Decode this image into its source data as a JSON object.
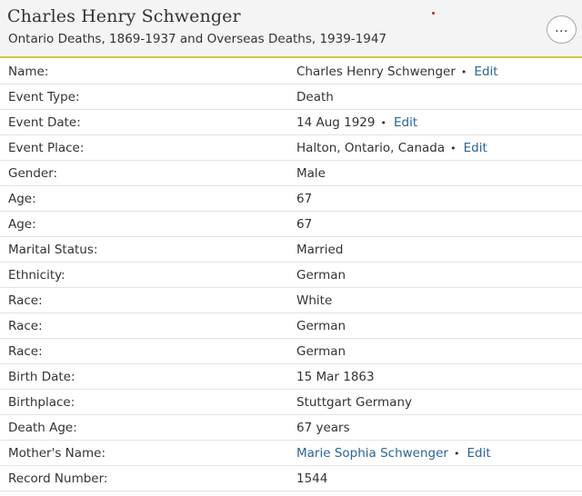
{
  "header": {
    "person_name": "Charles Henry Schwenger",
    "collection_title": "Ontario Deaths, 1869-1937 and Overseas Deaths, 1939-1947",
    "more_label": "...",
    "accent_color": "#c8cc3c"
  },
  "bullet": "•",
  "rows": [
    {
      "label": "Name:",
      "value": "Charles Henry Schwenger",
      "edit": "Edit"
    },
    {
      "label": "Event Type:",
      "value": "Death"
    },
    {
      "label": "Event Date:",
      "value": "14 Aug 1929",
      "edit": "Edit"
    },
    {
      "label": "Event Place:",
      "value": "Halton, Ontario, Canada",
      "edit": "Edit"
    },
    {
      "label": "Gender:",
      "value": "Male"
    },
    {
      "label": "Age:",
      "value": "67"
    },
    {
      "label": "Age:",
      "value": "67"
    },
    {
      "label": "Marital Status:",
      "value": "Married"
    },
    {
      "label": "Ethnicity:",
      "value": "German"
    },
    {
      "label": "Race:",
      "value": "White"
    },
    {
      "label": "Race:",
      "value": "German"
    },
    {
      "label": "Race:",
      "value": "German"
    },
    {
      "label": "Birth Date:",
      "value": "15 Mar 1863"
    },
    {
      "label": "Birthplace:",
      "value": "Stuttgart Germany"
    },
    {
      "label": "Death Age:",
      "value": "67 years"
    },
    {
      "label": "Mother's Name:",
      "value": "Marie Sophia Schwenger",
      "edit": "Edit"
    },
    {
      "label": "Record Number:",
      "value": "1544"
    }
  ]
}
